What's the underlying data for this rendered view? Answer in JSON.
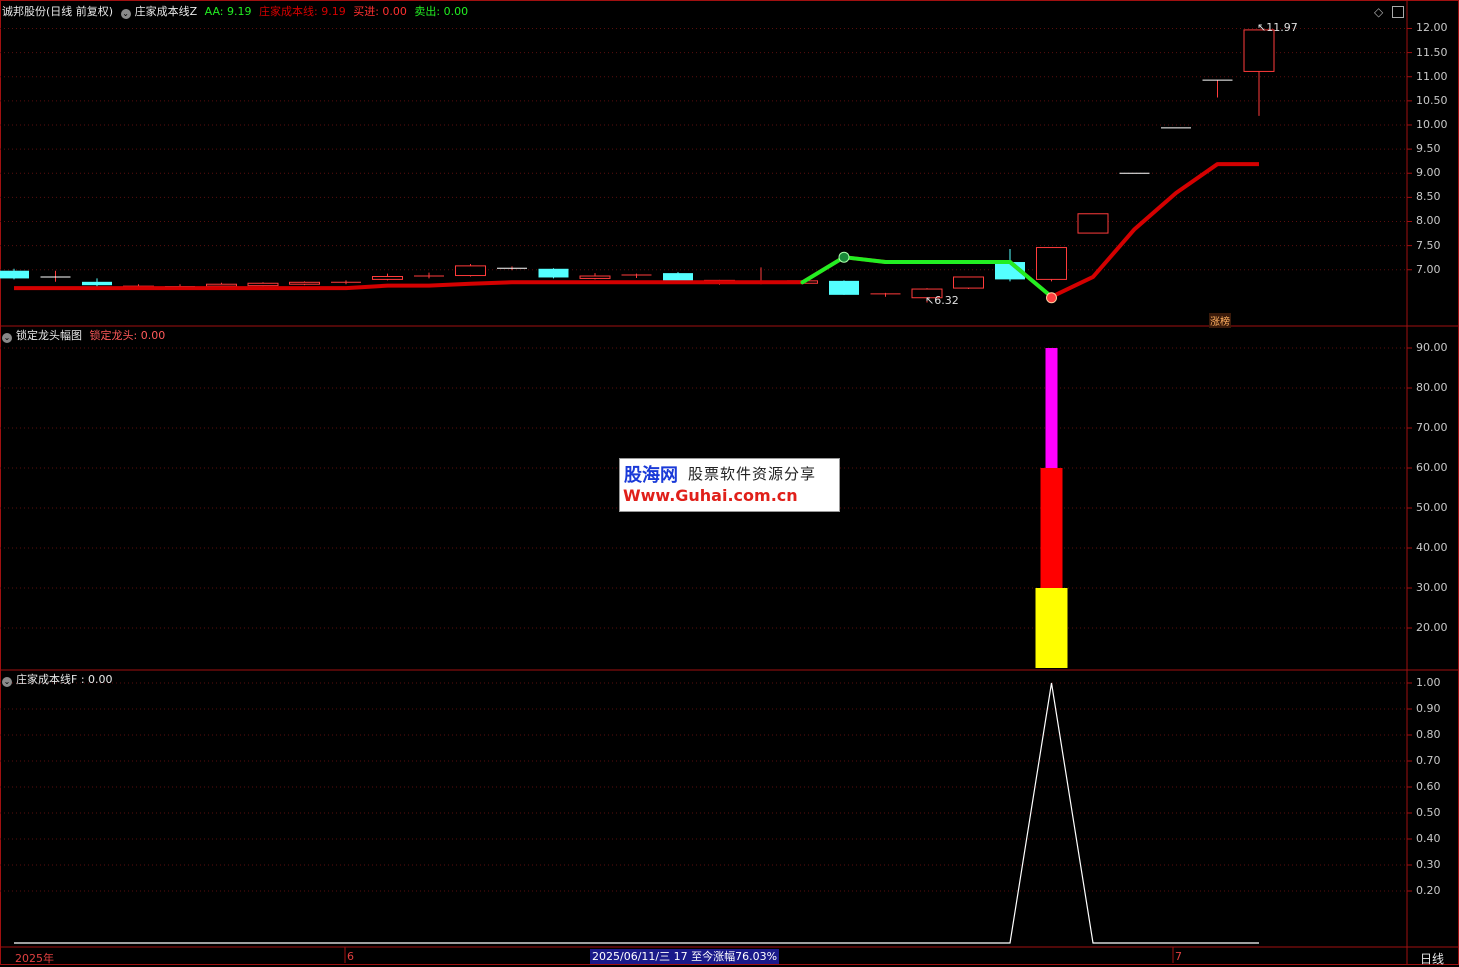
{
  "header": {
    "stock": "诚邦股份(日线 前复权)",
    "indicator": "庄家成本线Z",
    "aa_label": "AA: 9.19",
    "cost_label": "庄家成本线: 9.19",
    "buy_label": "买进: 0.00",
    "sell_label": "卖出: 0.00"
  },
  "panel2_header": {
    "name": "锁定龙头幅图",
    "value": "锁定龙头: 0.00"
  },
  "panel3_header": {
    "name": "庄家成本线F : 0.00"
  },
  "price_axis": [
    "12.00",
    "11.50",
    "11.00",
    "10.50",
    "10.00",
    "9.50",
    "9.00",
    "8.50",
    "8.00",
    "7.50",
    "7.00"
  ],
  "panel2_axis": [
    "90.00",
    "80.00",
    "70.00",
    "60.00",
    "50.00",
    "40.00",
    "30.00",
    "20.00"
  ],
  "panel3_axis": [
    "1.00",
    "0.90",
    "0.80",
    "0.70",
    "0.60",
    "0.50",
    "0.40",
    "0.30",
    "0.20"
  ],
  "annotations": {
    "high": "11.97",
    "low": "6.32",
    "limit_up": "涨榜"
  },
  "bottom": {
    "year": "2025年",
    "m6": "6",
    "m7": "7",
    "status": "2025/06/11/三 17 至今涨幅76.03%",
    "period": "日线"
  },
  "watermark": {
    "brand": "股海网",
    "slogan": "股票软件资源分享",
    "url": "Www.Guhai.com.cn"
  },
  "colors": {
    "up": "#ff3b3b",
    "down": "#54ffff",
    "cost_line": "#d40000",
    "green_line": "#22ee22",
    "magenta": "#ff00ff",
    "red": "#ff0000",
    "yellow": "#ffff00"
  },
  "chart_data": [
    {
      "type": "candlestick",
      "title": "",
      "ylim": [
        6.0,
        12.3
      ],
      "candles": [
        {
          "o": 6.98,
          "h": 7.02,
          "l": 6.8,
          "c": 6.82
        },
        {
          "o": 6.85,
          "h": 6.98,
          "l": 6.75,
          "c": 6.85
        },
        {
          "o": 6.75,
          "h": 6.82,
          "l": 6.65,
          "c": 6.68
        },
        {
          "o": 6.6,
          "h": 6.7,
          "l": 6.58,
          "c": 6.66
        },
        {
          "o": 6.65,
          "h": 6.7,
          "l": 6.6,
          "c": 6.65
        },
        {
          "o": 6.66,
          "h": 6.73,
          "l": 6.62,
          "c": 6.7
        },
        {
          "o": 6.67,
          "h": 6.74,
          "l": 6.63,
          "c": 6.72
        },
        {
          "o": 6.7,
          "h": 6.76,
          "l": 6.68,
          "c": 6.74
        },
        {
          "o": 6.72,
          "h": 6.78,
          "l": 6.7,
          "c": 6.74
        },
        {
          "o": 6.8,
          "h": 6.92,
          "l": 6.78,
          "c": 6.86
        },
        {
          "o": 6.86,
          "h": 6.94,
          "l": 6.82,
          "c": 6.87
        },
        {
          "o": 6.88,
          "h": 7.12,
          "l": 6.86,
          "c": 7.08
        },
        {
          "o": 7.03,
          "h": 7.07,
          "l": 6.99,
          "c": 7.03
        },
        {
          "o": 7.02,
          "h": 7.03,
          "l": 6.82,
          "c": 6.84
        },
        {
          "o": 6.82,
          "h": 6.93,
          "l": 6.8,
          "c": 6.87
        },
        {
          "o": 6.86,
          "h": 6.92,
          "l": 6.83,
          "c": 6.89
        },
        {
          "o": 6.93,
          "h": 6.95,
          "l": 6.75,
          "c": 6.76
        },
        {
          "o": 6.72,
          "h": 6.79,
          "l": 6.69,
          "c": 6.78
        },
        {
          "o": 6.75,
          "h": 7.05,
          "l": 6.7,
          "c": 6.75
        },
        {
          "o": 6.72,
          "h": 6.78,
          "l": 6.7,
          "c": 6.77
        },
        {
          "o": 6.77,
          "h": 6.78,
          "l": 6.48,
          "c": 6.48
        },
        {
          "o": 6.48,
          "h": 6.52,
          "l": 6.44,
          "c": 6.5
        },
        {
          "o": 6.42,
          "h": 6.62,
          "l": 6.32,
          "c": 6.6
        },
        {
          "o": 6.62,
          "h": 6.85,
          "l": 6.6,
          "c": 6.85
        },
        {
          "o": 7.16,
          "h": 7.43,
          "l": 6.76,
          "c": 6.8
        },
        {
          "o": 6.8,
          "h": 7.46,
          "l": 6.76,
          "c": 7.46
        },
        {
          "o": 7.76,
          "h": 8.16,
          "l": 7.76,
          "c": 8.16
        },
        {
          "o": 9.0,
          "h": 9.0,
          "l": 9.0,
          "c": 9.0
        },
        {
          "o": 9.94,
          "h": 9.94,
          "l": 9.94,
          "c": 9.94
        },
        {
          "o": 10.93,
          "h": 10.93,
          "l": 10.57,
          "c": 10.93
        },
        {
          "o": 11.11,
          "h": 11.97,
          "l": 10.19,
          "c": 11.97
        }
      ],
      "cost_line": [
        6.62,
        6.62,
        6.62,
        6.62,
        6.62,
        6.62,
        6.62,
        6.62,
        6.62,
        6.67,
        6.67,
        6.71,
        6.74,
        6.74,
        6.74,
        6.74,
        6.74,
        6.74,
        6.74,
        6.74,
        7.26,
        7.16,
        7.16,
        7.16,
        7.16,
        6.44,
        6.85,
        7.84,
        8.59,
        9.19,
        9.19
      ],
      "green_segments": [
        [
          19,
          20
        ],
        [
          20,
          21
        ],
        [
          21,
          22
        ],
        [
          22,
          23
        ],
        [
          23,
          24
        ],
        [
          24,
          25
        ]
      ]
    },
    {
      "type": "bar",
      "title": "锁定龙头幅图",
      "ylim": [
        10,
        95
      ],
      "stack_at_index": 25,
      "segments": [
        {
          "from": 10,
          "to": 30,
          "color": "yellow"
        },
        {
          "from": 30,
          "to": 60,
          "color": "red"
        },
        {
          "from": 60,
          "to": 90,
          "color": "magenta"
        }
      ]
    },
    {
      "type": "line",
      "title": "庄家成本线F",
      "ylim": [
        0,
        1.05
      ],
      "values": [
        0,
        0,
        0,
        0,
        0,
        0,
        0,
        0,
        0,
        0,
        0,
        0,
        0,
        0,
        0,
        0,
        0,
        0,
        0,
        0,
        0,
        0,
        0,
        0,
        0,
        1,
        0,
        0,
        0,
        0,
        0
      ]
    }
  ]
}
